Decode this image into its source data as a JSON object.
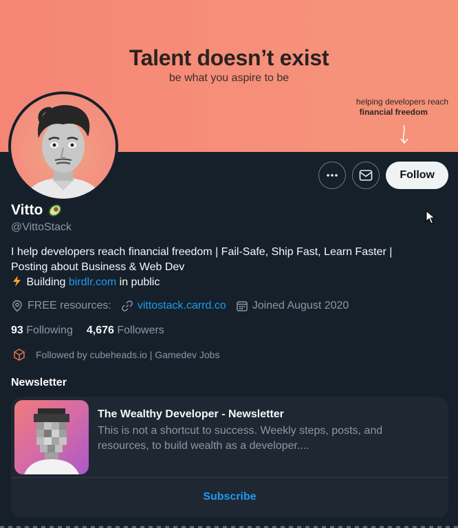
{
  "banner": {
    "headline": "Talent doesn’t exist",
    "subline": "be what you aspire to be",
    "help_line1": "helping developers reach",
    "help_line2": "financial freedom"
  },
  "actions": {
    "more_icon": "more-horizontal-icon",
    "message_icon": "envelope-icon",
    "follow_label": "Follow"
  },
  "profile": {
    "name": "Vitto",
    "name_emoji": "avocado",
    "handle": "@VittoStack",
    "bio_line1": "I help developers reach financial freedom | Fail-Safe, Ship Fast, Learn Faster |",
    "bio_line2": "Posting about Business & Web Dev",
    "bio_line3_prefix": "Building",
    "bio_line3_link": "birdlr.com",
    "bio_line3_suffix": "in public"
  },
  "meta": {
    "location": "FREE resources:",
    "website": "vittostack.carrd.co",
    "joined": "Joined August 2020"
  },
  "stats": {
    "following_count": "93",
    "following_label": "Following",
    "followers_count": "4,676",
    "followers_label": "Followers"
  },
  "followed_by": "Followed by cubeheads.io | Gamedev Jobs",
  "newsletter": {
    "heading": "Newsletter",
    "title": "The Wealthy Developer - Newsletter",
    "description": "This is not a shortcut to success. Weekly steps, posts, and resources, to build wealth as a developer....",
    "subscribe_label": "Subscribe"
  },
  "colors": {
    "background": "#15202b",
    "accent": "#1d9bf0",
    "banner": "#f58575"
  }
}
